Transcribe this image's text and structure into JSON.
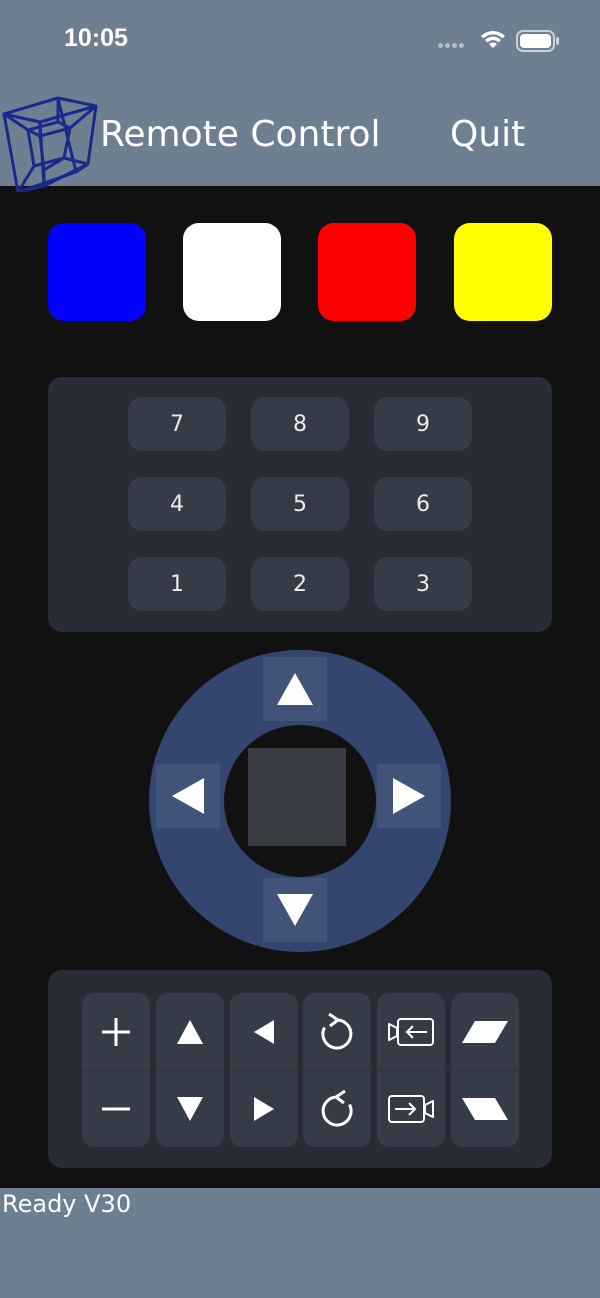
{
  "status_bar": {
    "time": "10:05",
    "icons": [
      "signal-dots-icon",
      "wifi-icon",
      "battery-icon"
    ]
  },
  "header": {
    "title": "Remote Control",
    "quit_label": "Quit",
    "logo_icon": "tesseract-cube-icon"
  },
  "color_buttons": [
    {
      "name": "blue",
      "color": "#0000ff"
    },
    {
      "name": "white",
      "color": "#ffffff"
    },
    {
      "name": "red",
      "color": "#ff0000"
    },
    {
      "name": "yellow",
      "color": "#ffff00"
    }
  ],
  "numpad": {
    "rows": [
      [
        "7",
        "8",
        "9"
      ],
      [
        "4",
        "5",
        "6"
      ],
      [
        "1",
        "2",
        "3"
      ]
    ]
  },
  "dpad": {
    "icons": [
      "arrow-up-icon",
      "arrow-left-icon",
      "arrow-right-icon",
      "arrow-down-icon"
    ],
    "ring_color": "#344670"
  },
  "controls": [
    {
      "top_icon": "plus-icon",
      "bottom_icon": "minus-icon"
    },
    {
      "top_icon": "triangle-up-icon",
      "bottom_icon": "triangle-down-icon"
    },
    {
      "top_icon": "triangle-left-icon",
      "bottom_icon": "triangle-right-icon"
    },
    {
      "top_icon": "rotate-ccw-icon",
      "bottom_icon": "rotate-cw-icon"
    },
    {
      "top_icon": "camera-in-icon",
      "bottom_icon": "camera-out-icon"
    },
    {
      "top_icon": "skew-right-icon",
      "bottom_icon": "skew-left-icon"
    }
  ],
  "footer": {
    "status_text": "Ready V30"
  },
  "colors": {
    "bar": "#6f7f92",
    "background": "#111112",
    "panel": "#272c36",
    "key": "#353b47"
  }
}
